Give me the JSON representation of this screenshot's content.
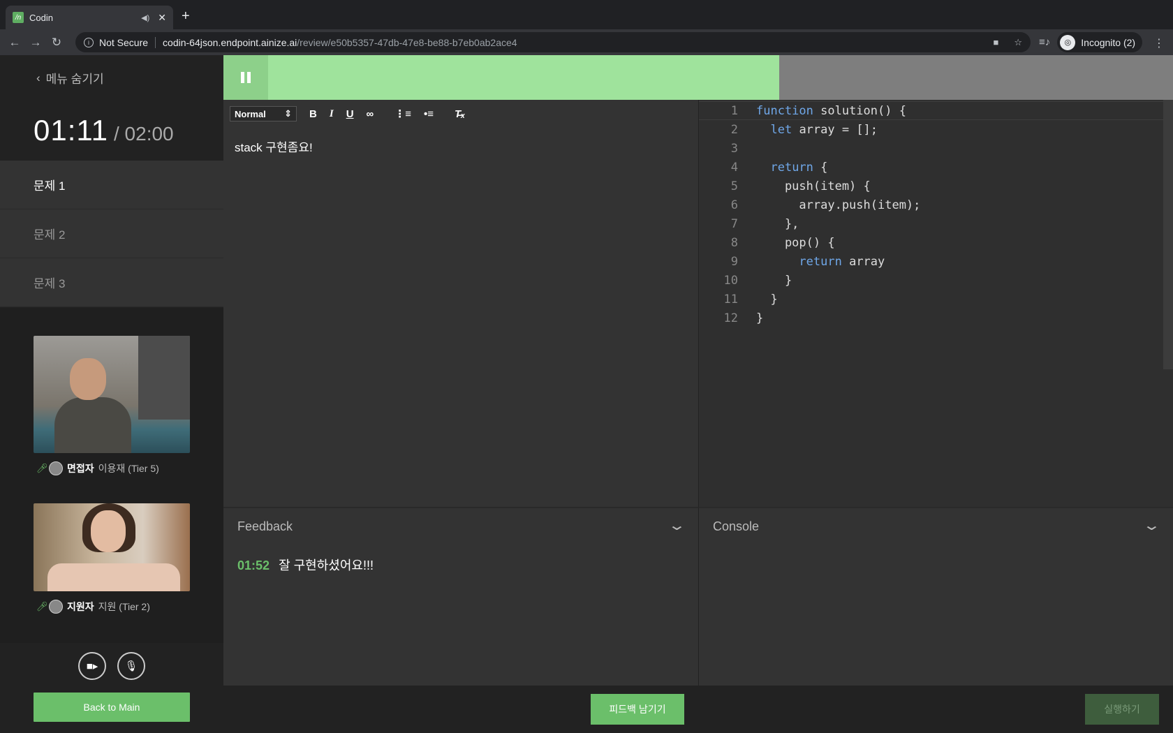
{
  "browser": {
    "tab_title": "Codin",
    "favicon_text": "/n",
    "url_security": "Not Secure",
    "url_host": "codin-64json.endpoint.ainize.ai",
    "url_path": "/review/e50b5357-47db-47e8-be88-b7eb0ab2ace4",
    "profile_label": "Incognito (2)"
  },
  "sidebar": {
    "hide_menu_label": "메뉴 숨기기",
    "timer_current": "01:11",
    "timer_total": "/ 02:00",
    "problems": [
      {
        "label": "문제 1",
        "active": true
      },
      {
        "label": "문제 2",
        "active": false
      },
      {
        "label": "문제 3",
        "active": false
      }
    ],
    "participants": [
      {
        "role": "면접자",
        "name": "이용재 (Tier 5)"
      },
      {
        "role": "지원자",
        "name": "지원 (Tier 2)"
      }
    ],
    "back_label": "Back to Main"
  },
  "progress": {
    "fraction": 0.585,
    "fill_color": "#9fe39c"
  },
  "editor": {
    "format_select": "Normal",
    "content": "stack 구현좀요!"
  },
  "code": {
    "lines": [
      "function solution() {",
      "  let array = [];",
      "",
      "  return {",
      "    push(item) {",
      "      array.push(item);",
      "    },",
      "    pop() {",
      "      return array",
      "    }",
      "  }",
      "}"
    ],
    "keywords": [
      "function",
      "let",
      "return"
    ]
  },
  "feedback": {
    "title": "Feedback",
    "entries": [
      {
        "time": "01:52",
        "text": "잘 구현하셨어요!!!"
      }
    ]
  },
  "console": {
    "title": "Console"
  },
  "actions": {
    "leave_feedback": "피드백 남기기",
    "run": "실행하기"
  },
  "colors": {
    "accent": "#6bbf6a",
    "keyword": "#6fa7e8"
  }
}
